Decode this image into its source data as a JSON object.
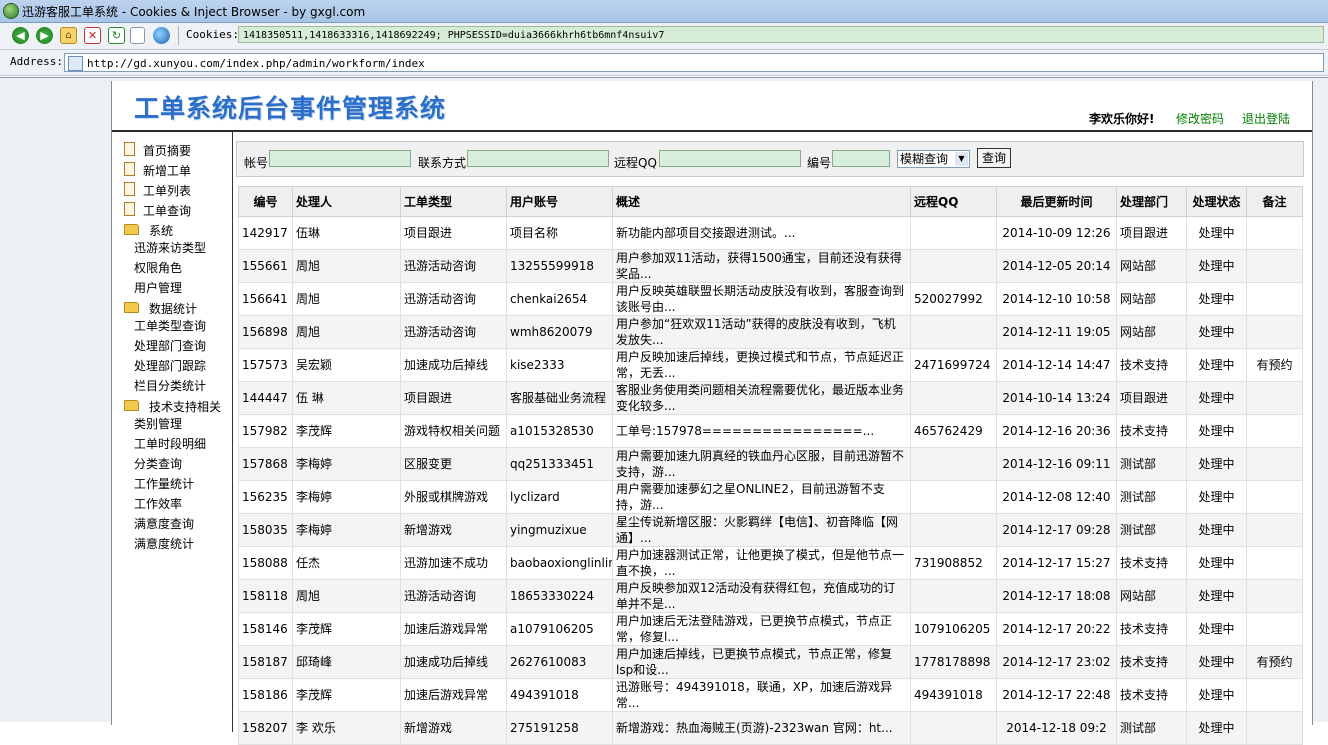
{
  "window": {
    "title": "迅游客服工单系统 - Cookies & Inject Browser - by gxgl.com"
  },
  "toolbar": {
    "cookies_label": "Cookies:",
    "cookies_value": "1418350511,1418633316,1418692249; PHPSESSID=duia3666khrh6tb6mnf4nsuiv7"
  },
  "address": {
    "label": "Address:",
    "url": "http://gd.xunyou.com/index.php/admin/workform/index"
  },
  "header": {
    "title": "工单系统后台事件管理系统",
    "greeting": "李欢乐你好!",
    "change_password": "修改密码",
    "logout": "退出登陆"
  },
  "sidebar": {
    "top_items": [
      "首页摘要",
      "新增工单",
      "工单列表",
      "工单查询"
    ],
    "sections": [
      {
        "label": "系统",
        "items": [
          "迅游来访类型",
          "权限角色",
          "用户管理"
        ]
      },
      {
        "label": "数据统计",
        "items": [
          "工单类型查询",
          "处理部门查询",
          "处理部门跟踪",
          "栏目分类统计"
        ]
      },
      {
        "label": "技术支持相关",
        "items": [
          "类别管理",
          "工单时段明细",
          "分类查询",
          "工作量统计",
          "工作效率",
          "满意度查询",
          "满意度统计"
        ]
      }
    ]
  },
  "search": {
    "account_label": "帐号",
    "contact_label": "联系方式",
    "qq_label": "远程QQ",
    "id_label": "编号",
    "mode_value": "模糊查询",
    "button_label": "查询"
  },
  "table": {
    "columns": [
      "编号",
      "处理人",
      "工单类型",
      "用户账号",
      "概述",
      "远程QQ",
      "最后更新时间",
      "处理部门",
      "处理状态",
      "备注"
    ],
    "rows": [
      [
        "142917",
        "伍琳",
        "项目跟进",
        "项目名称",
        "新功能内部项目交接跟进测试。...",
        "",
        "2014-10-09 12:26",
        "项目跟进",
        "处理中",
        ""
      ],
      [
        "155661",
        "周旭",
        "迅游活动咨询",
        "13255599918",
        "用户参加双11活动，获得1500通宝，目前还没有获得奖品...",
        "",
        "2014-12-05 20:14",
        "网站部",
        "处理中",
        ""
      ],
      [
        "156641",
        "周旭",
        "迅游活动咨询",
        "chenkai2654",
        "用户反映英雄联盟长期活动皮肤没有收到，客服查询到该账号由...",
        "520027992",
        "2014-12-10 10:58",
        "网站部",
        "处理中",
        ""
      ],
      [
        "156898",
        "周旭",
        "迅游活动咨询",
        "wmh8620079",
        "用户参加“狂欢双11活动”获得的皮肤没有收到，飞机发放失...",
        "",
        "2014-12-11 19:05",
        "网站部",
        "处理中",
        ""
      ],
      [
        "157573",
        "吴宏颖",
        "加速成功后掉线",
        "kise2333",
        "用户反映加速后掉线，更换过模式和节点，节点延迟正常，无丢...",
        "2471699724",
        "2014-12-14 14:47",
        "技术支持",
        "处理中",
        "有预约"
      ],
      [
        "144447",
        "伍 琳",
        "项目跟进",
        "客服基础业务流程",
        "客服业务使用类问题相关流程需要优化，最近版本业务变化较多...",
        "",
        "2014-10-14 13:24",
        "项目跟进",
        "处理中",
        ""
      ],
      [
        "157982",
        "李茂辉",
        "游戏特权相关问题",
        "a1015328530",
        "工单号:157978================...",
        "465762429",
        "2014-12-16 20:36",
        "技术支持",
        "处理中",
        ""
      ],
      [
        "157868",
        "李梅婷",
        "区服变更",
        "qq251333451",
        "用户需要加速九阴真经的铁血丹心区服，目前迅游暂不支持，游...",
        "",
        "2014-12-16 09:11",
        "测试部",
        "处理中",
        ""
      ],
      [
        "156235",
        "李梅婷",
        "外服或棋牌游戏",
        "lyclizard",
        "用户需要加速夢幻之星ONLINE2，目前迅游暂不支持，游...",
        "",
        "2014-12-08 12:40",
        "测试部",
        "处理中",
        ""
      ],
      [
        "158035",
        "李梅婷",
        "新增游戏",
        "yingmuzixue",
        "星尘传说新增区服：火影羁绊【电信】、初音降临【网通】...",
        "",
        "2014-12-17 09:28",
        "测试部",
        "处理中",
        ""
      ],
      [
        "158088",
        "任杰",
        "迅游加速不成功",
        "baobaoxionglinlin",
        "用户加速器测试正常，让他更换了模式，但是他节点一直不换，...",
        "731908852",
        "2014-12-17 15:27",
        "技术支持",
        "处理中",
        ""
      ],
      [
        "158118",
        "周旭",
        "迅游活动咨询",
        "18653330224",
        "用户反映参加双12活动没有获得红包，充值成功的订单并不是...",
        "",
        "2014-12-17 18:08",
        "网站部",
        "处理中",
        ""
      ],
      [
        "158146",
        "李茂辉",
        "加速后游戏异常",
        "a1079106205",
        "用户加速后无法登陆游戏，已更换节点模式，节点正常，修复l...",
        "1079106205",
        "2014-12-17 20:22",
        "技术支持",
        "处理中",
        ""
      ],
      [
        "158187",
        "邱琦峰",
        "加速成功后掉线",
        "2627610083",
        "用户加速后掉线，已更换节点模式，节点正常，修复lsp和设...",
        "1778178898",
        "2014-12-17 23:02",
        "技术支持",
        "处理中",
        "有预约"
      ],
      [
        "158186",
        "李茂辉",
        "加速后游戏异常",
        "494391018",
        "迅游账号：494391018，联通，XP，加速后游戏异常...",
        "494391018",
        "2014-12-17 22:48",
        "技术支持",
        "处理中",
        ""
      ],
      [
        "158207",
        "李 欢乐",
        "新增游戏",
        "275191258",
        "新增游戏：热血海贼王(页游)-2323wan 官网：ht...",
        "",
        "2014-12-18 09:2",
        "测试部",
        "处理中",
        ""
      ]
    ]
  }
}
